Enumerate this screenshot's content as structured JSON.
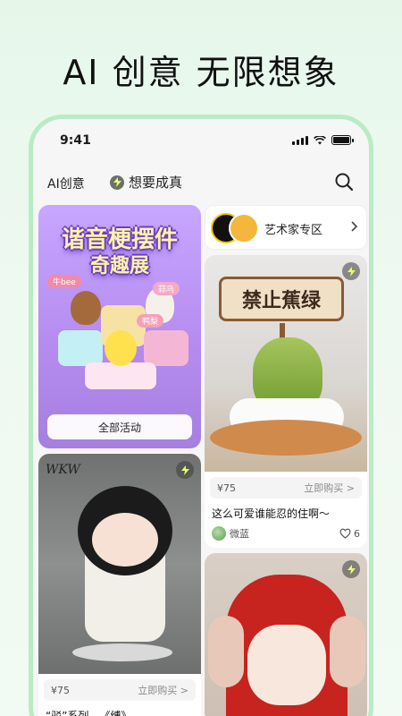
{
  "headline": "AI 创意 无限想象",
  "status": {
    "time": "9:41"
  },
  "nav": {
    "tab_main": "AI创意",
    "tab_dream": "想要成真"
  },
  "banner": {
    "title_line1": "谐音梗摆件",
    "title_line2": "奇趣展",
    "tag1": "牛bee",
    "tag2": "蒜鸟",
    "tag3": "鸭梨",
    "button": "全部活动"
  },
  "artist_zone": {
    "label": "艺术家专区"
  },
  "product_right": {
    "sign_text": "禁止蕉绿",
    "price": "¥75",
    "buy_label": "立即购买 >",
    "name": "这么可爱谁能忍的住啊～",
    "user": "微蓝",
    "likes": "6"
  },
  "product_left": {
    "watermark": "WKW",
    "price": "¥75",
    "buy_label": "立即购买 >",
    "name": "“驳”系列—《缚》"
  },
  "colors": {
    "accent_green": "#b9ebc5",
    "banner_purple": "#b68cf0"
  }
}
